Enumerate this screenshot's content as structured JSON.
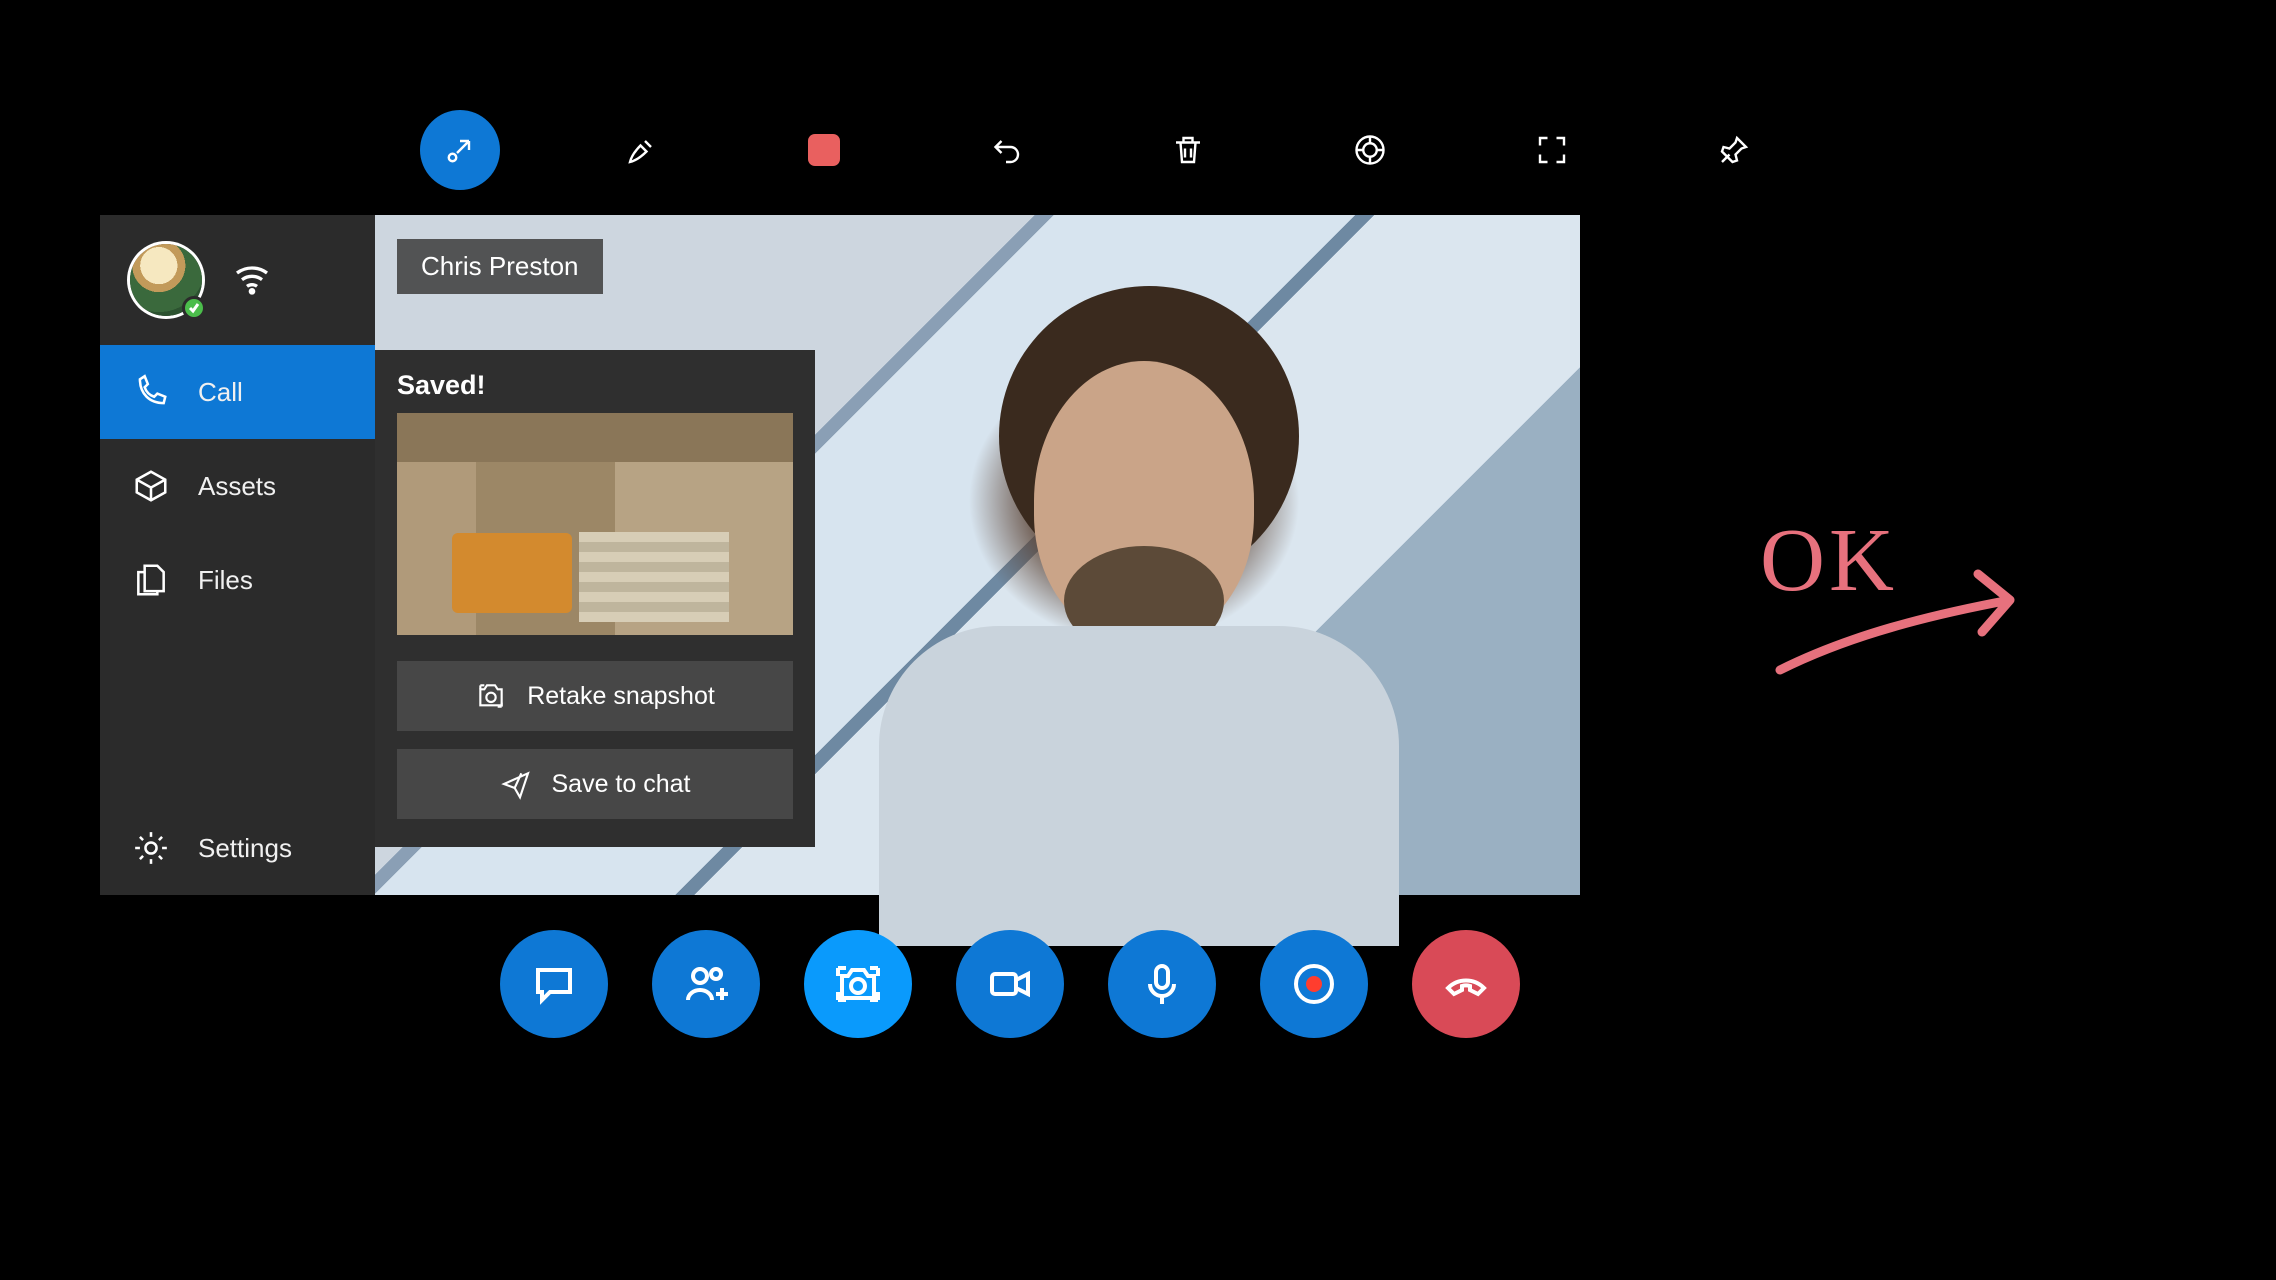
{
  "toolbar": {
    "items": [
      "collapse",
      "pen",
      "stop",
      "undo",
      "delete",
      "camera-settings",
      "fullscreen",
      "pin"
    ]
  },
  "caller": {
    "name": "Chris Preston"
  },
  "sidebar": {
    "items": [
      {
        "id": "call",
        "label": "Call",
        "active": true
      },
      {
        "id": "assets",
        "label": "Assets",
        "active": false
      },
      {
        "id": "files",
        "label": "Files",
        "active": false
      }
    ],
    "settings_label": "Settings"
  },
  "snapshot": {
    "title": "Saved!",
    "retake_label": "Retake snapshot",
    "save_label": "Save to chat"
  },
  "call_bar": {
    "buttons": [
      "chat",
      "add-people",
      "snapshot",
      "video",
      "mic",
      "record",
      "hangup"
    ]
  },
  "handwriting": {
    "text": "OK"
  },
  "colors": {
    "accent": "#0e78d5",
    "accent_bright": "#0a9afc",
    "danger": "#d94a57",
    "ink": "#e7717d"
  }
}
